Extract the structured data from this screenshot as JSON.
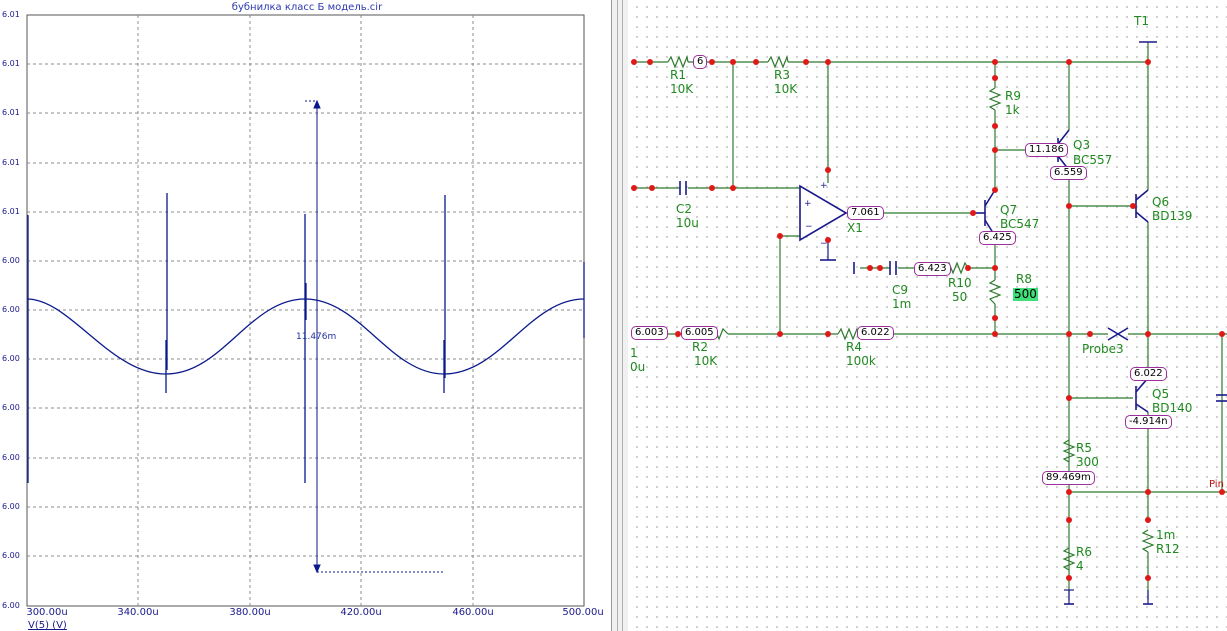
{
  "plot": {
    "title": "бубнилка класс Б модель.cir",
    "y_ticks": [
      "6.01",
      "6.01",
      "6.01",
      "6.01",
      "6.01",
      "6.00",
      "6.00",
      "6.00",
      "6.00",
      "6.00",
      "6.00",
      "6.00",
      "6.00"
    ],
    "x_ticks": [
      "300.00u",
      "340.00u",
      "380.00u",
      "420.00u",
      "460.00u",
      "500.00u"
    ],
    "y_label": "V(5) (V)",
    "cursor_readout": "11.476m"
  },
  "colors": {
    "waveform": "#0a1a8c",
    "grid": "#8c8c8c",
    "wire": "#2d7a2d",
    "node": "#e01818",
    "label_green": "#1f8a1f",
    "value_border": "#9b2f9b",
    "selection": "#3fe07a",
    "component": "#1a1a8c"
  },
  "schematic": {
    "components": {
      "r1": {
        "name": "R1",
        "value": "10K"
      },
      "r3": {
        "name": "R3",
        "value": "10K"
      },
      "r9": {
        "name": "R9",
        "value": "1k"
      },
      "q3": {
        "name": "Q3",
        "value": "BC557"
      },
      "t1": {
        "name": "T1"
      },
      "c2": {
        "name": "C2",
        "value": "10u"
      },
      "x1": {
        "name": "X1"
      },
      "q7": {
        "name": "Q7",
        "value": "BC547"
      },
      "q6": {
        "name": "Q6",
        "value": "BD139"
      },
      "c9": {
        "name": "C9",
        "value": "1m"
      },
      "r10": {
        "name": "R10",
        "value": "50"
      },
      "r8": {
        "name": "R8",
        "value": "500"
      },
      "r2": {
        "name": "R2",
        "value": "10K"
      },
      "r4": {
        "name": "R4",
        "value": "100k"
      },
      "probe3": {
        "name": "Probe3"
      },
      "c1": {
        "name": "1",
        "value": "0u"
      },
      "q5": {
        "name": "Q5",
        "value": "BD140"
      },
      "r5": {
        "name": "R5",
        "value": "300"
      },
      "r6": {
        "name": "R6",
        "value": "4"
      },
      "r12": {
        "name": "R12",
        "value": "1m"
      },
      "pin": {
        "name": "Pin"
      }
    },
    "node_values": {
      "n6": "6",
      "q3b": "11.186",
      "q3c": "6.559",
      "x1out": "7.061",
      "q7e": "6.425",
      "r10": "6.423",
      "in": "6.003",
      "r2": "6.005",
      "r4": "6.022",
      "q5": "6.022",
      "q5e": "-4.914n",
      "r5": "89.469m"
    }
  }
}
